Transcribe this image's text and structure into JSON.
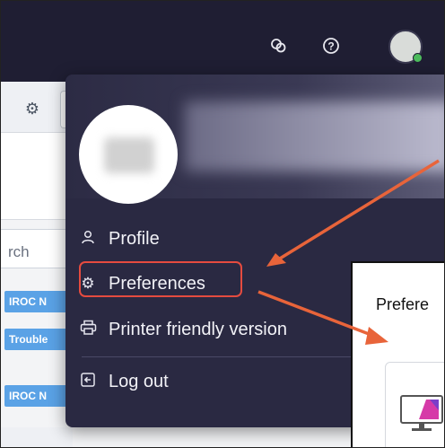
{
  "colors": {
    "topbar": "#1f1e33",
    "menu_bg": "#2a2942",
    "highlight": "#e54b3f",
    "arrow": "#e8643a",
    "tag": "#5aa2e6",
    "presence": "#4cbb5c"
  },
  "topbar": {
    "chat_icon": "chat-bubbles-icon",
    "help_icon": "help-circle-icon"
  },
  "left_panel": {
    "search_text": "rch",
    "tags": [
      "IROC N",
      "Trouble",
      "IROC N"
    ]
  },
  "menu": {
    "items": [
      {
        "label": "Profile",
        "icon": "user-icon"
      },
      {
        "label": "Preferences",
        "icon": "gear-icon"
      },
      {
        "label": "Printer friendly version",
        "icon": "printer-icon"
      },
      {
        "label": "Log out",
        "icon": "logout-icon"
      }
    ]
  },
  "preview": {
    "title": "Prefere"
  }
}
